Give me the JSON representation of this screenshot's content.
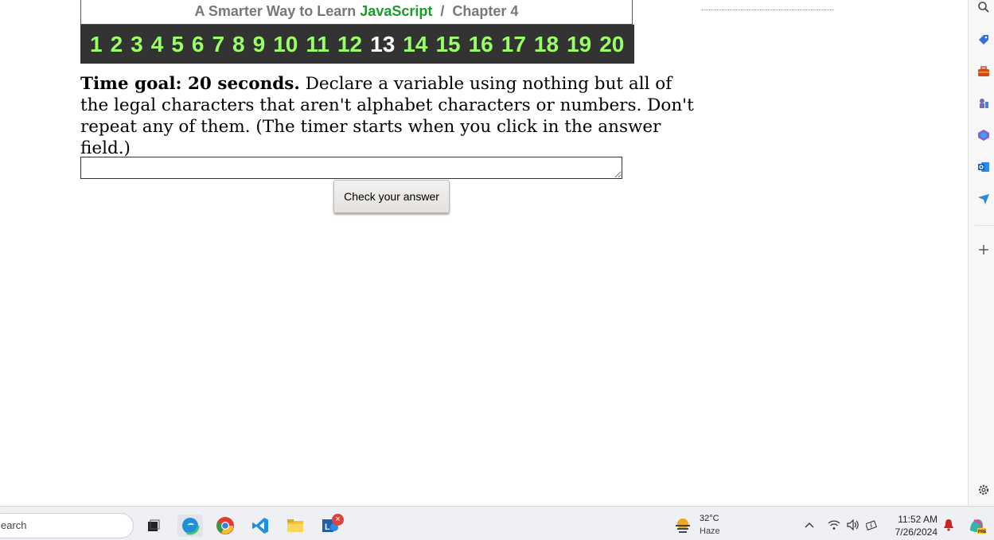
{
  "header": {
    "prefix": "A Smarter Way to Learn",
    "brand": "JavaScript",
    "separator": "/",
    "chapter": "Chapter 4"
  },
  "chapters": [
    "1",
    "2",
    "3",
    "4",
    "5",
    "6",
    "7",
    "8",
    "9",
    "10",
    "11",
    "12",
    "13",
    "14",
    "15",
    "16",
    "17",
    "18",
    "19",
    "20"
  ],
  "current_chapter": "13",
  "question": {
    "goal": "Time goal: 20 seconds.",
    "text": " Declare a variable using nothing but all of the legal characters that aren't alphabet characters or numbers. Don't repeat any of them. (The timer starts when you click in the answer field.)"
  },
  "answer": {
    "value": ""
  },
  "check_button": {
    "label": "Check your answer"
  },
  "taskbar": {
    "search_placeholder": "earch",
    "weather": {
      "temp": "32°C",
      "condition": "Haze"
    },
    "clock": {
      "time": "11:52 AM",
      "date": "7/26/2024"
    },
    "badge": "×"
  },
  "colors": {
    "chapter_link": "#99ff66",
    "current_chapter": "#ffffff",
    "bar_bg": "#333333",
    "brand": "#1a9a2a"
  }
}
